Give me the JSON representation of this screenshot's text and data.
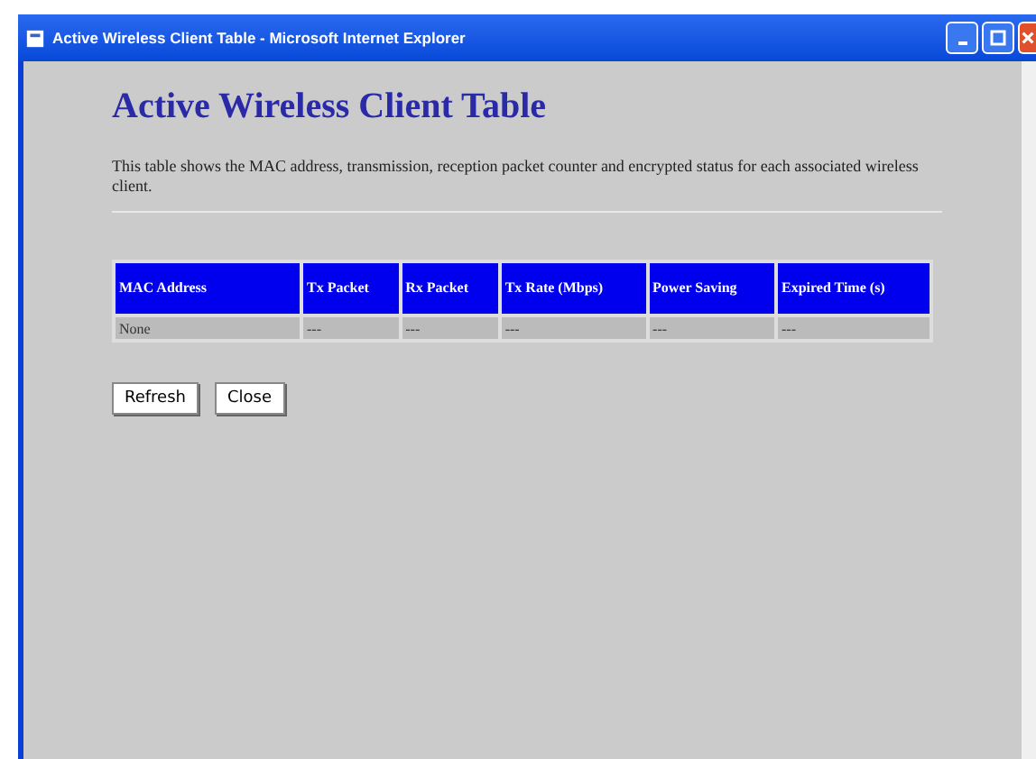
{
  "window": {
    "title": "Active Wireless Client Table - Microsoft Internet Explorer"
  },
  "heading": "Active Wireless Client Table",
  "description": "This table shows the MAC address, transmission, reception packet counter and encrypted status for each associated wireless client.",
  "table": {
    "columns": [
      "MAC Address",
      "Tx Packet",
      "Rx Packet",
      "Tx Rate (Mbps)",
      "Power Saving",
      "Expired Time (s)"
    ],
    "rows": [
      [
        "None",
        "---",
        "---",
        "---",
        "---",
        "---"
      ]
    ]
  },
  "buttons": [
    "Refresh",
    "Close"
  ]
}
